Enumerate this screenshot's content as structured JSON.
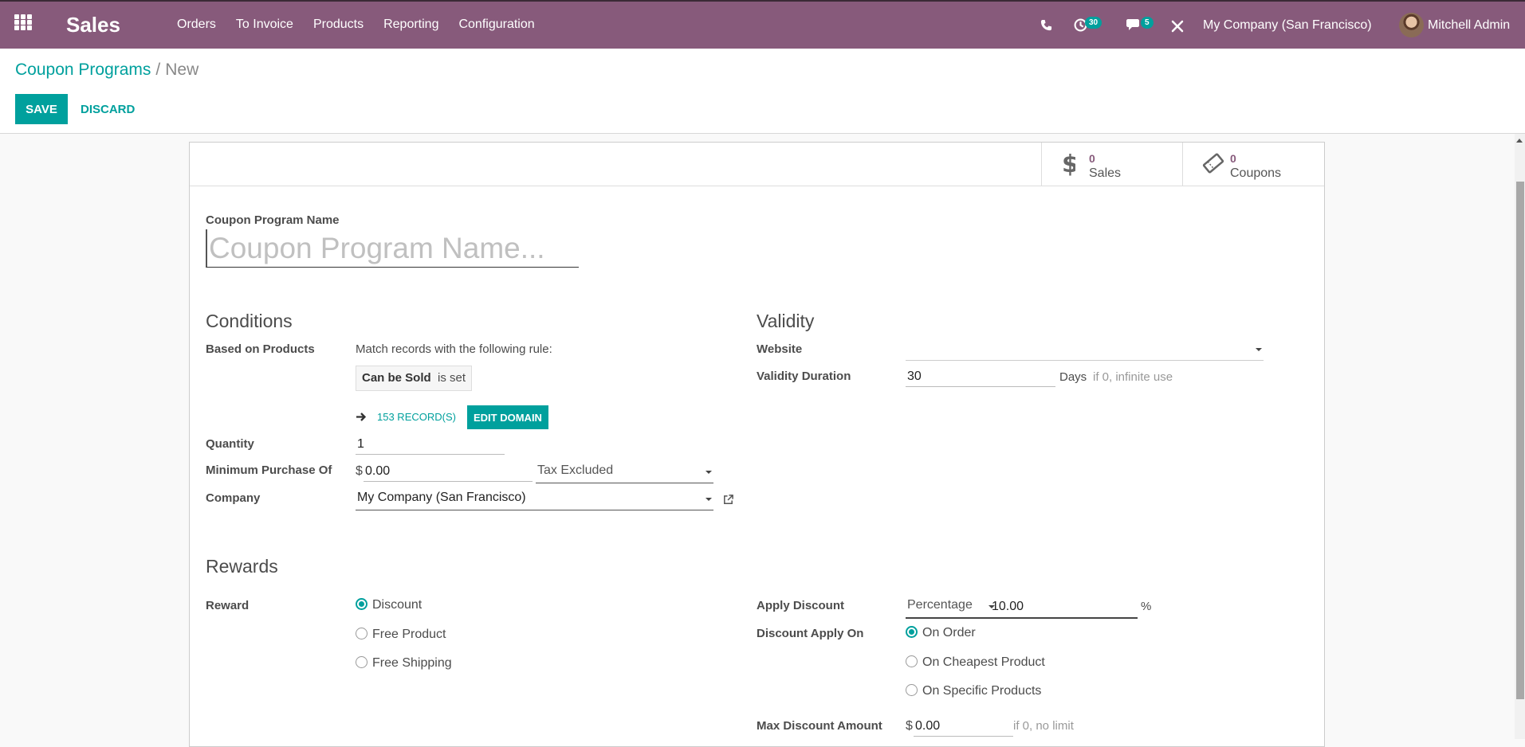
{
  "navbar": {
    "app_name": "Sales",
    "menu": [
      "Orders",
      "To Invoice",
      "Products",
      "Reporting",
      "Configuration"
    ],
    "activity_badge": "30",
    "messages_badge": "5",
    "company": "My Company (San Francisco)",
    "user": "Mitchell Admin",
    "color": "#875a7b"
  },
  "breadcrumb": {
    "parent": "Coupon Programs",
    "separator": "/",
    "current": "New"
  },
  "actions": {
    "save": "SAVE",
    "discard": "DISCARD"
  },
  "stat_buttons": {
    "sales": {
      "value": "0",
      "label": "Sales"
    },
    "coupons": {
      "value": "0",
      "label": "Coupons"
    }
  },
  "form": {
    "name_label": "Coupon Program Name",
    "name_placeholder": "Coupon Program Name...",
    "conditions": {
      "title": "Conditions",
      "based_on_products_label": "Based on Products",
      "rule_text": "Match records with the following rule:",
      "domain_field": "Can be Sold",
      "domain_op": "is set",
      "records_link": "153 RECORD(S)",
      "edit_domain": "EDIT DOMAIN",
      "quantity_label": "Quantity",
      "quantity_value": "1",
      "min_purchase_label": "Minimum Purchase Of",
      "currency_symbol": "$",
      "min_purchase_value": "0.00",
      "tax_mode": "Tax Excluded",
      "company_label": "Company",
      "company_value": "My Company (San Francisco)"
    },
    "validity": {
      "title": "Validity",
      "website_label": "Website",
      "website_value": "",
      "duration_label": "Validity Duration",
      "duration_value": "30",
      "duration_unit": "Days",
      "duration_hint": "if 0, infinite use"
    },
    "rewards": {
      "title": "Rewards",
      "reward_label": "Reward",
      "reward_options": [
        {
          "label": "Discount",
          "selected": true
        },
        {
          "label": "Free Product",
          "selected": false
        },
        {
          "label": "Free Shipping",
          "selected": false
        }
      ],
      "apply_discount_label": "Apply Discount",
      "discount_type": "Percentage",
      "discount_value": "10.00",
      "discount_unit": "%",
      "apply_on_label": "Discount Apply On",
      "apply_on_options": [
        {
          "label": "On Order",
          "selected": true
        },
        {
          "label": "On Cheapest Product",
          "selected": false
        },
        {
          "label": "On Specific Products",
          "selected": false
        }
      ],
      "max_discount_label": "Max Discount Amount",
      "max_discount_currency": "$",
      "max_discount_value": "0.00",
      "max_discount_hint": "if 0, no limit"
    }
  },
  "accent_color": "#00a09d"
}
